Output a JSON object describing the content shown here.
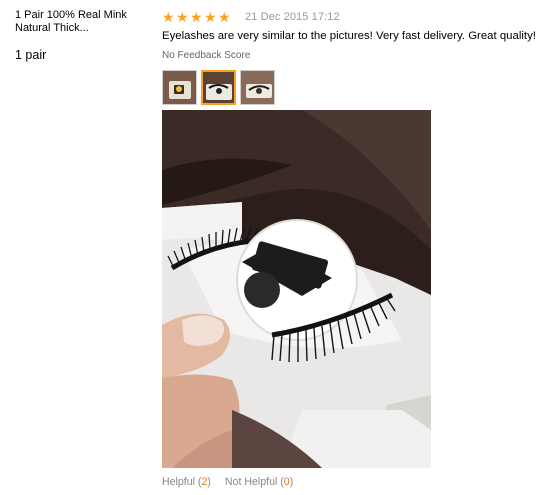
{
  "product": {
    "title_line1": "1 Pair 100% Real Mink",
    "title_line2": "Natural Thick...",
    "variant": "1 pair"
  },
  "review": {
    "rating": 5,
    "star_glyph": "★",
    "date": "21 Dec 2015 17:12",
    "text": "Eyelashes are very similar to the pictures! Very fast delivery. Great quality!",
    "score_note": "No Feedback Score",
    "thumbnails": [
      "thumbnail-1",
      "thumbnail-2",
      "thumbnail-3"
    ],
    "selected_thumbnail": 2
  },
  "feedback": {
    "helpful_label": "Helpful",
    "helpful_count": "2",
    "not_helpful_label": "Not Helpful",
    "not_helpful_count": "0"
  },
  "colors": {
    "star": "#f7a221",
    "date": "#999999",
    "count": "#e07a1f",
    "thumb_selected_border": "#f7a221"
  }
}
